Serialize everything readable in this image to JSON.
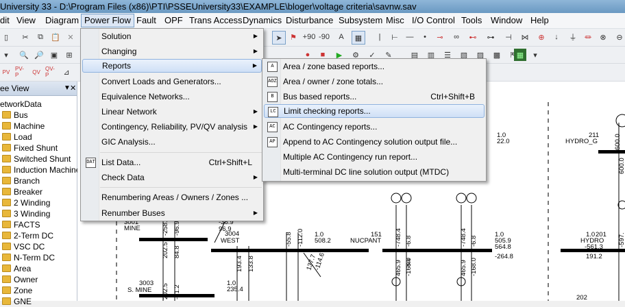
{
  "title": "University 33 - D:\\Program Files (x86)\\PTI\\PSSEUniversity33\\EXAMPLE\\bloger\\voltage criteria\\savnw.sav",
  "menubar": [
    "dit",
    "View",
    "Diagram",
    "Power Flow",
    "Fault",
    "OPF",
    "Trans Access",
    "Dynamics",
    "Disturbance",
    "Subsystem",
    "Misc",
    "I/O Control",
    "Tools",
    "Window",
    "Help"
  ],
  "toolbar": {
    "b1": "+90",
    "b2": "-90"
  },
  "tree": {
    "header": "ee View",
    "root": "etworkData",
    "items": [
      "Bus",
      "Machine",
      "Load",
      "Fixed Shunt",
      "Switched Shunt",
      "Induction Machine",
      "Branch",
      "Breaker",
      "2 Winding",
      "3 Winding",
      "FACTS",
      "2-Term DC",
      "VSC DC",
      "N-Term DC",
      "Area",
      "Owner",
      "Zone",
      "GNE"
    ]
  },
  "power_flow_menu": {
    "items": [
      {
        "label": "Solution",
        "arrow": true
      },
      {
        "label": "Changing",
        "arrow": true
      },
      {
        "label": "Reports",
        "arrow": true,
        "highlighted": true
      },
      {
        "label": "Convert Loads and Generators..."
      },
      {
        "label": "Equivalence Networks..."
      },
      {
        "label": "Linear Network",
        "arrow": true
      },
      {
        "label": "Contingency, Reliability, PV/QV analysis",
        "arrow": true
      },
      {
        "label": "GIC Analysis..."
      },
      {
        "label": "List Data...",
        "shortcut": "Ctrl+Shift+L",
        "icon": "DAT"
      },
      {
        "label": "Check Data",
        "arrow": true
      },
      {
        "label": "Renumbering Areas / Owners / Zones ..."
      },
      {
        "label": "Renumber Buses",
        "arrow": true
      }
    ]
  },
  "reports_menu": {
    "items": [
      {
        "label": "Area / zone based reports...",
        "icon": "A"
      },
      {
        "label": "Area / owner / zone totals...",
        "icon": "AOZ"
      },
      {
        "label": "Bus based reports...",
        "shortcut": "Ctrl+Shift+B",
        "icon": "B"
      },
      {
        "label": "Limit checking reports...",
        "icon": "LC",
        "highlighted": true
      },
      {
        "label": "AC Contingency reports...",
        "icon": "AC"
      },
      {
        "label": "Append to AC Contingency solution output file...",
        "icon": "AP"
      },
      {
        "label": "Multiple AC Contingency run report..."
      },
      {
        "label": "Multi-terminal DC line solution output (MTDC)"
      }
    ]
  },
  "diagram": {
    "labels": {
      "b3001_num": "3001",
      "b3001_name": "MINE",
      "b3004_num": "3004",
      "b3004_name": "WEST",
      "b3003_num": "3003",
      "b3003_name": "S. MINE",
      "b151_num": "151",
      "b151_name": "NUCPANT",
      "b201_num": "201",
      "b201_name": "HYDRO",
      "b211_num": "211",
      "b211_name": "HYDRO_G",
      "b202_num": "202",
      "v1": "1.0",
      "v2": "508.2",
      "v3": "1.0",
      "v4": "235.4",
      "v5": "1.0",
      "v6": "505.9",
      "v7": "564.8",
      "v8": "-264.8",
      "v9": "1.0",
      "v10": "-561.3",
      "v11": "191.2",
      "v12": "1.0",
      "v13": "22.0",
      "f1": "-258.",
      "f2": "-96.9",
      "f3": "202.5",
      "f4": "84.8",
      "f5": "-55.8",
      "f6": "-112.0",
      "f7": "193.4",
      "f8": "133.8",
      "f9": "-748.4",
      "f10": "-6.8",
      "f11": "465.9",
      "f12": "-168.0",
      "f13": "-748.4",
      "f14": "-6.8",
      "f15": "465.9",
      "f16": "-168.0",
      "f17": "202.5",
      "f18": "-81.2",
      "f19": "96.9",
      "f20": "-36.9",
      "f21": "137.7",
      "f22": "-114.6",
      "f23": "600.0",
      "f24": "600.0",
      "f25": "-597.",
      "f26": "644"
    }
  }
}
